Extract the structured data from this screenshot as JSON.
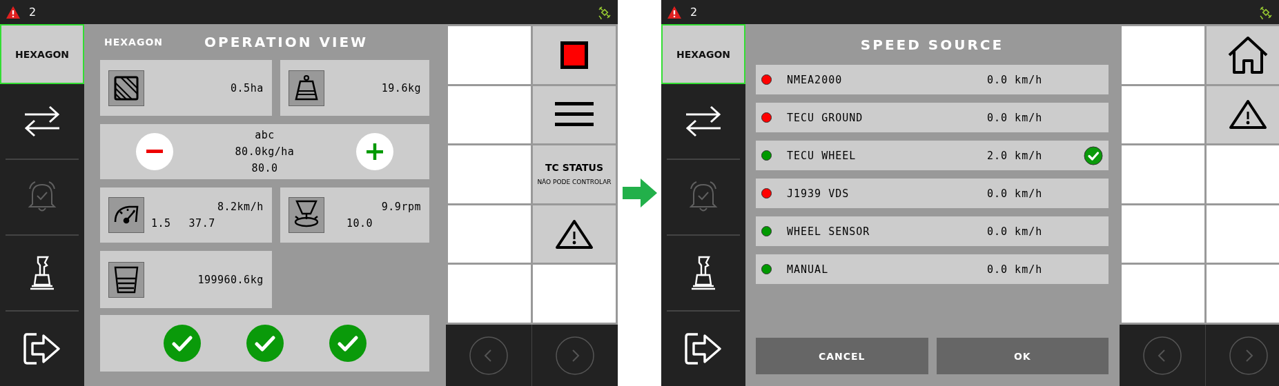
{
  "screens": [
    {
      "kind": "operation",
      "status_bar": {
        "alarm_count": "2"
      },
      "sidebar": [
        {
          "kind": "brand",
          "label": "HEXAGON",
          "selected": true
        },
        {
          "kind": "swap",
          "disabled": false
        },
        {
          "kind": "alarm",
          "disabled": true
        },
        {
          "kind": "joystick",
          "disabled": false
        },
        {
          "kind": "exit",
          "disabled": false
        }
      ],
      "header": {
        "brand": "HEXAGON",
        "title": "OPERATION VIEW"
      },
      "tiles": [
        {
          "kind": "area",
          "lines": [
            "0.5ha"
          ]
        },
        {
          "kind": "weight",
          "lines": [
            "19.6kg"
          ]
        },
        {
          "kind": "rate",
          "lines": [
            "abc",
            "80.0kg/ha",
            "80.0"
          ]
        },
        {
          "kind": "speed",
          "lines": [
            "8.2km/h",
            "1.5",
            "37.7"
          ]
        },
        {
          "kind": "spinner",
          "lines": [
            "9.9rpm",
            "10.0"
          ]
        },
        {
          "kind": "hopper",
          "lines": [
            "199960.6kg"
          ]
        }
      ],
      "sections": [
        {
          "on": true
        },
        {
          "on": true
        },
        {
          "on": true
        }
      ],
      "softkeys": [
        {
          "kind": "empty"
        },
        {
          "kind": "stop"
        },
        {
          "kind": "empty"
        },
        {
          "kind": "menu"
        },
        {
          "kind": "empty"
        },
        {
          "kind": "status",
          "title": "TC STATUS",
          "subtitle": "NÃO PODE CONTROLAR"
        },
        {
          "kind": "empty"
        },
        {
          "kind": "warning"
        },
        {
          "kind": "empty"
        },
        {
          "kind": "empty"
        }
      ]
    },
    {
      "kind": "speed_source",
      "status_bar": {
        "alarm_count": "2"
      },
      "sidebar": [
        {
          "kind": "brand",
          "label": "HEXAGON",
          "selected": true
        },
        {
          "kind": "swap",
          "disabled": false
        },
        {
          "kind": "alarm",
          "disabled": true
        },
        {
          "kind": "joystick",
          "disabled": false
        },
        {
          "kind": "exit",
          "disabled": false
        }
      ],
      "title": "SPEED SOURCE",
      "sources": [
        {
          "name": "NMEA2000",
          "speed": "0.0 km/h",
          "color": "#ff0000",
          "selected": false
        },
        {
          "name": "TECU GROUND",
          "speed": "0.0 km/h",
          "color": "#ff0000",
          "selected": false
        },
        {
          "name": "TECU WHEEL",
          "speed": "2.0 km/h",
          "color": "#009900",
          "selected": true
        },
        {
          "name": "J1939 VDS",
          "speed": "0.0 km/h",
          "color": "#ff0000",
          "selected": false
        },
        {
          "name": "WHEEL SENSOR",
          "speed": "0.0 km/h",
          "color": "#009900",
          "selected": false
        },
        {
          "name": "MANUAL",
          "speed": "0.0 km/h",
          "color": "#009900",
          "selected": false
        }
      ],
      "buttons": [
        "CANCEL",
        "OK"
      ],
      "softkeys": [
        {
          "kind": "empty"
        },
        {
          "kind": "home"
        },
        {
          "kind": "empty"
        },
        {
          "kind": "warning"
        },
        {
          "kind": "empty"
        },
        {
          "kind": "empty"
        },
        {
          "kind": "empty"
        },
        {
          "kind": "empty"
        },
        {
          "kind": "empty"
        },
        {
          "kind": "empty"
        }
      ]
    }
  ]
}
